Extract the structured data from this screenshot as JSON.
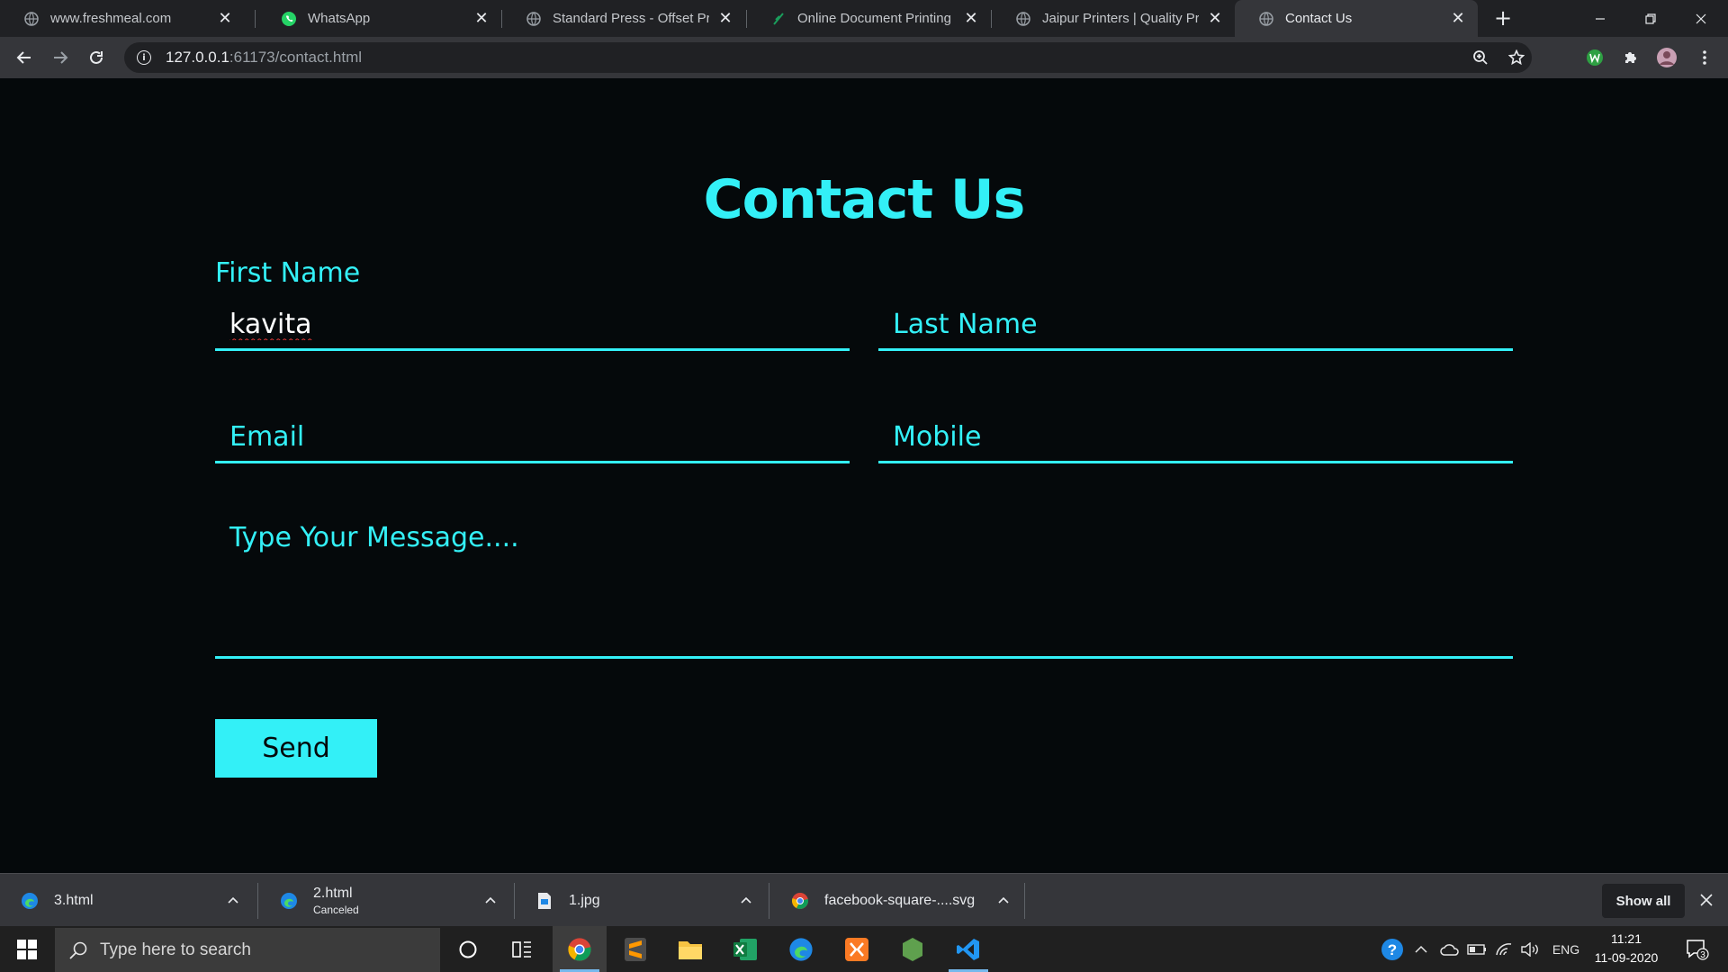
{
  "browser": {
    "tabs": [
      {
        "title": "www.freshmeal.com",
        "icon": "globe-icon"
      },
      {
        "title": "WhatsApp",
        "icon": "whatsapp-icon"
      },
      {
        "title": "Standard Press - Offset Printi",
        "icon": "globe-icon"
      },
      {
        "title": "Online Document Printing at",
        "icon": "printing-site-icon"
      },
      {
        "title": "Jaipur Printers | Quality Printi",
        "icon": "globe-icon"
      },
      {
        "title": "Contact Us",
        "icon": "globe-icon",
        "active": true
      }
    ],
    "url_host": "127.0.0.1",
    "url_rest": ":61173/contact.html"
  },
  "page": {
    "title": "Contact Us",
    "first_name_label": "First Name",
    "first_name_value": "kavita",
    "last_name_placeholder": "Last Name",
    "email_placeholder": "Email",
    "mobile_placeholder": "Mobile",
    "message_placeholder": "Type Your Message....",
    "send_label": "Send"
  },
  "downloads": {
    "items": [
      {
        "name": "3.html",
        "status": "",
        "icon": "edge-icon"
      },
      {
        "name": "2.html",
        "status": "Canceled",
        "icon": "edge-icon"
      },
      {
        "name": "1.jpg",
        "status": "",
        "icon": "image-file-icon"
      },
      {
        "name": "facebook-square-....svg",
        "status": "",
        "icon": "chrome-icon"
      }
    ],
    "show_all_label": "Show all"
  },
  "taskbar": {
    "search_placeholder": "Type here to search",
    "language": "ENG",
    "time": "11:21",
    "date": "11-09-2020",
    "notification_count": "3"
  },
  "colors": {
    "accent": "#33f0f7",
    "page_background": "#05090b",
    "chrome_dark": "#202124",
    "chrome_toolbar": "#35363a"
  }
}
